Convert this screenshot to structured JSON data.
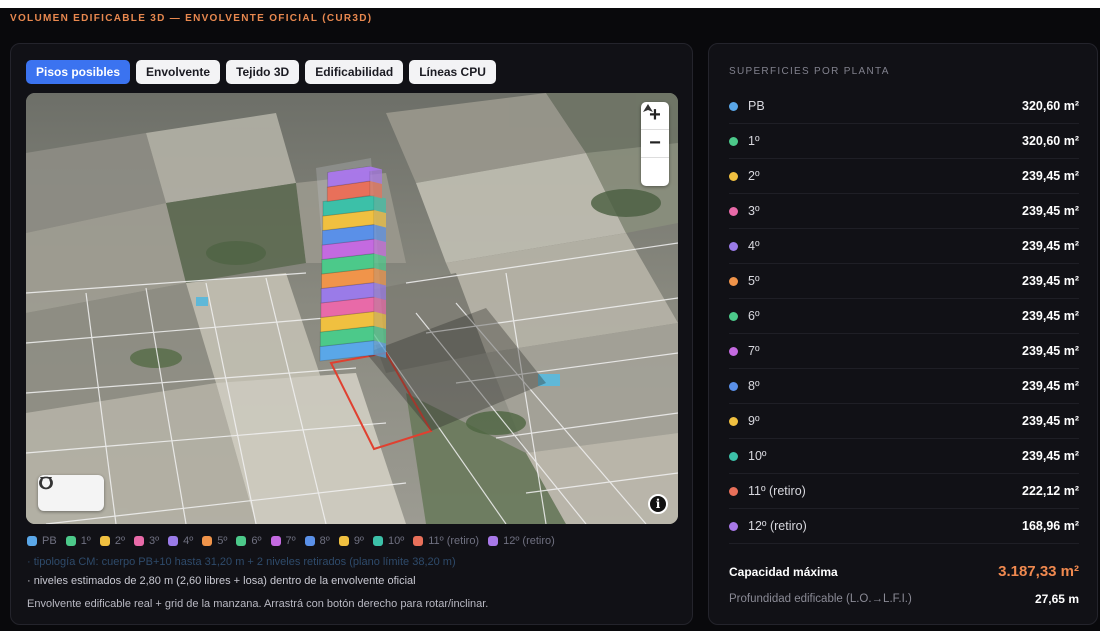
{
  "page": {
    "title": "VOLUMEN EDIFICABLE 3D — ENVOLVENTE OFICIAL (CUR3D)"
  },
  "tabs": [
    {
      "label": "Pisos posibles",
      "active": true
    },
    {
      "label": "Envolvente",
      "active": false
    },
    {
      "label": "Tejido 3D",
      "active": false
    },
    {
      "label": "Edificabilidad",
      "active": false
    },
    {
      "label": "Líneas CPU",
      "active": false
    }
  ],
  "map": {
    "zoom_in_label": "+",
    "zoom_out_label": "−",
    "info_label": "i"
  },
  "legend": [
    {
      "label": "PB",
      "color": "#5aa7e8"
    },
    {
      "label": "1º",
      "color": "#4cc98a"
    },
    {
      "label": "2º",
      "color": "#f0c040"
    },
    {
      "label": "3º",
      "color": "#e86aa8"
    },
    {
      "label": "4º",
      "color": "#9a7be8"
    },
    {
      "label": "5º",
      "color": "#f0944a"
    },
    {
      "label": "6º",
      "color": "#4cc98a"
    },
    {
      "label": "7º",
      "color": "#c46ae0"
    },
    {
      "label": "8º",
      "color": "#5a90e8"
    },
    {
      "label": "9º",
      "color": "#f0c040"
    },
    {
      "label": "10º",
      "color": "#3cc0a8"
    },
    {
      "label": "11º (retiro)",
      "color": "#e8705a"
    },
    {
      "label": "12º (retiro)",
      "color": "#a878e8"
    }
  ],
  "notes": {
    "tipologia": "· tipología CM: cuerpo PB+10 hasta 31,20 m + 2 niveles retirados (plano límite 38,20 m)",
    "niveles": "· niveles estimados de 2,80 m (2,60 libres + losa) dentro de la envolvente oficial",
    "envolvente": "Envolvente edificable real + grid de la manzana. Arrastrá con botón derecho para rotar/inclinar."
  },
  "superficies": {
    "title": "SUPERFICIES POR PLANTA",
    "floors": [
      {
        "name": "PB",
        "value": "320,60 m²",
        "color": "#5aa7e8"
      },
      {
        "name": "1º",
        "value": "320,60 m²",
        "color": "#4cc98a"
      },
      {
        "name": "2º",
        "value": "239,45 m²",
        "color": "#f0c040"
      },
      {
        "name": "3º",
        "value": "239,45 m²",
        "color": "#e86aa8"
      },
      {
        "name": "4º",
        "value": "239,45 m²",
        "color": "#9a7be8"
      },
      {
        "name": "5º",
        "value": "239,45 m²",
        "color": "#f0944a"
      },
      {
        "name": "6º",
        "value": "239,45 m²",
        "color": "#4cc98a"
      },
      {
        "name": "7º",
        "value": "239,45 m²",
        "color": "#c46ae0"
      },
      {
        "name": "8º",
        "value": "239,45 m²",
        "color": "#5a90e8"
      },
      {
        "name": "9º",
        "value": "239,45 m²",
        "color": "#f0c040"
      },
      {
        "name": "10º",
        "value": "239,45 m²",
        "color": "#3cc0a8"
      },
      {
        "name": "11º (retiro)",
        "value": "222,12 m²",
        "color": "#e8705a"
      },
      {
        "name": "12º (retiro)",
        "value": "168,96 m²",
        "color": "#a878e8"
      }
    ],
    "capacidad_label": "Capacidad máxima",
    "capacidad_value": "3.187,33 m²",
    "profundidad_label": "Profundidad edificable (L.O.→L.F.I.)",
    "profundidad_value": "27,65 m"
  }
}
